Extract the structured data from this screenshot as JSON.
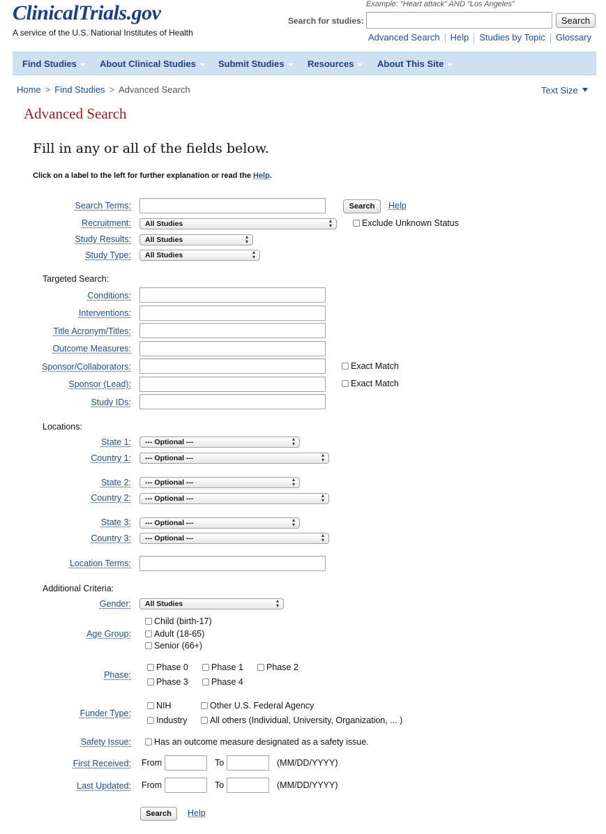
{
  "header": {
    "logo": "ClinicalTrials.gov",
    "tagline": "A service of the U.S. National Institutes of Health",
    "example": "Example: \"Heart attack\" AND \"Los Angeles\"",
    "search_label": "Search for studies:",
    "search_value": "",
    "search_button": "Search",
    "links": [
      "Advanced Search",
      "Help",
      "Studies by Topic",
      "Glossary"
    ]
  },
  "nav": [
    "Find Studies",
    "About Clinical Studies",
    "Submit Studies",
    "Resources",
    "About This Site"
  ],
  "breadcrumb": [
    "Home",
    "Find Studies",
    "Advanced Search"
  ],
  "text_size": "Text Size",
  "page_title": "Advanced Search",
  "subtitle": "Fill in any or all of the fields below.",
  "instructions": "Click on a label to the left for further explanation or read the",
  "instructions_help": "Help",
  "form": {
    "search_terms_label": "Search Terms:",
    "search_button": "Search",
    "help_link": "Help",
    "recruitment_label": "Recruitment:",
    "recruitment_value": "All Studies",
    "exclude_unknown": "Exclude Unknown Status",
    "study_results_label": "Study Results:",
    "study_results_value": "All Studies",
    "study_type_label": "Study Type:",
    "study_type_value": "All Studies",
    "targeted_search": "Targeted Search:",
    "conditions_label": "Conditions:",
    "interventions_label": "Interventions:",
    "title_label": "Title Acronym/Titles:",
    "outcome_label": "Outcome Measures:",
    "sponsor_collab_label": "Sponsor/Collaborators:",
    "sponsor_lead_label": "Sponsor (Lead):",
    "exact_match": "Exact Match",
    "study_ids_label": "Study IDs:",
    "locations": "Locations:",
    "state1_label": "State 1:",
    "country1_label": "Country 1:",
    "state2_label": "State 2:",
    "country2_label": "Country 2:",
    "state3_label": "State 3:",
    "country3_label": "Country 3:",
    "optional": "--- Optional ---",
    "location_terms_label": "Location Terms:",
    "additional_criteria": "Additional Criteria:",
    "gender_label": "Gender:",
    "gender_value": "All Studies",
    "age_group_label": "Age Group:",
    "age_child": "Child (birth-17)",
    "age_adult": "Adult (18-65)",
    "age_senior": "Senior (66+)",
    "phase_label": "Phase:",
    "phase0": "Phase 0",
    "phase1": "Phase 1",
    "phase2": "Phase 2",
    "phase3": "Phase 3",
    "phase4": "Phase 4",
    "funder_label": "Funder Type:",
    "funder_nih": "NIH",
    "funder_federal": "Other U.S. Federal Agency",
    "funder_industry": "Industry",
    "funder_others": "All others (Individual, University, Organization, ... )",
    "safety_label": "Safety Issue:",
    "safety_text": "Has an outcome measure designated as a safety issue.",
    "first_received_label": "First Received:",
    "last_updated_label": "Last Updated:",
    "from": "From",
    "to": "To",
    "date_format": "(MM/DD/YYYY)",
    "bottom_search": "Search",
    "bottom_help": "Help"
  },
  "colors": {
    "logo": "#1a3f86",
    "nav_bg": "#cfe1f0",
    "link": "#1f4e8c",
    "title": "#9b1b1b"
  }
}
